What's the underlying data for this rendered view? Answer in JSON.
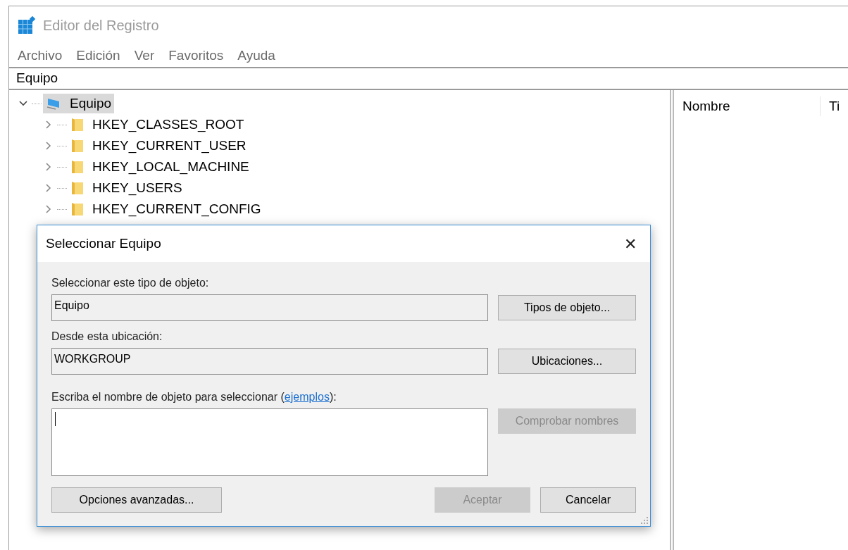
{
  "window": {
    "title": "Editor del Registro"
  },
  "menu": [
    "Archivo",
    "Edición",
    "Ver",
    "Favoritos",
    "Ayuda"
  ],
  "address": "Equipo",
  "tree": [
    {
      "label": "Equipo",
      "kind": "computer",
      "expanded": true,
      "selected": true,
      "children": [
        {
          "label": "HKEY_CLASSES_ROOT",
          "kind": "folder",
          "expanded": false,
          "selected": false
        },
        {
          "label": "HKEY_CURRENT_USER",
          "kind": "folder",
          "expanded": false,
          "selected": false
        },
        {
          "label": "HKEY_LOCAL_MACHINE",
          "kind": "folder",
          "expanded": false,
          "selected": false
        },
        {
          "label": "HKEY_USERS",
          "kind": "folder",
          "expanded": false,
          "selected": false
        },
        {
          "label": "HKEY_CURRENT_CONFIG",
          "kind": "folder",
          "expanded": false,
          "selected": false
        }
      ]
    }
  ],
  "list_columns": [
    "Nombre",
    "Ti"
  ],
  "dialog": {
    "title": "Seleccionar Equipo",
    "close": "✕",
    "object_type": {
      "label": "Seleccionar este tipo de objeto:",
      "value": "Equipo",
      "button": {
        "label": "Tipos de objeto...",
        "disabled": false
      }
    },
    "location": {
      "label": "Desde esta ubicación:",
      "value": "WORKGROUP",
      "button": {
        "label": "Ubicaciones...",
        "disabled": false
      }
    },
    "names": {
      "before": "Escriba el nombre de objeto para seleccionar (",
      "link": "ejemplos",
      "after": "):",
      "button": {
        "label": "Comprobar nombres",
        "disabled": true
      }
    },
    "buttons": [
      {
        "label": "Opciones avanzadas...",
        "disabled": false
      },
      {
        "label": "Aceptar",
        "disabled": true
      },
      {
        "label": "Cancelar",
        "disabled": false
      }
    ]
  }
}
